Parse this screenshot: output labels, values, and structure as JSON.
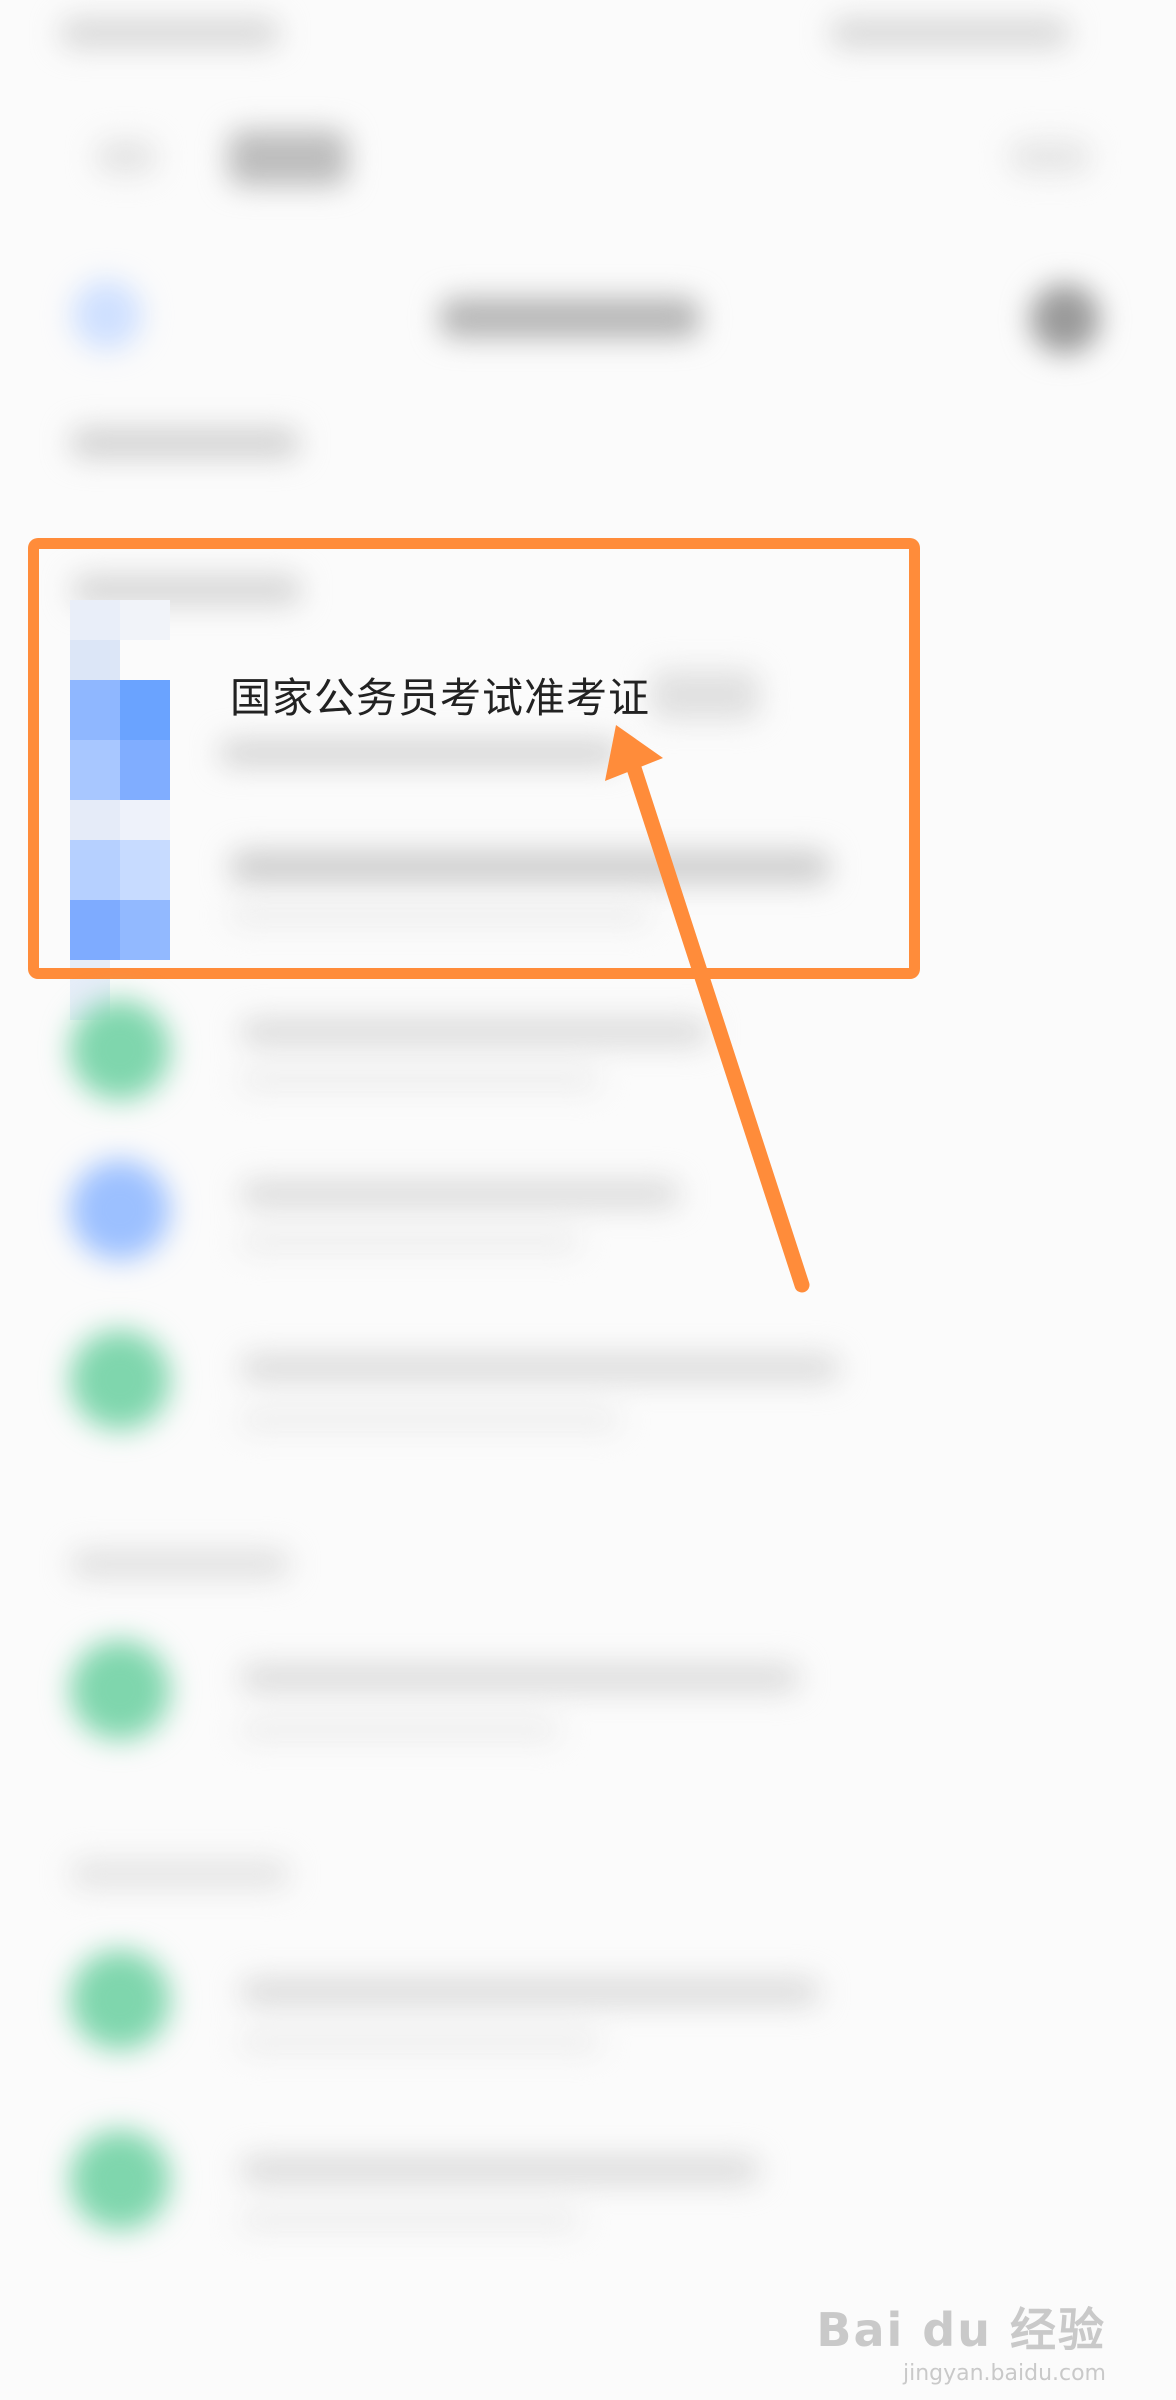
{
  "result_item": {
    "title": "国家公务员考试准考证"
  },
  "annotation": {
    "box_color": "#ff8c3a",
    "arrow_color": "#ff8c3a"
  },
  "watermark": {
    "brand": "Bai du 经验",
    "url": "jingyan.baidu.com"
  },
  "colors": {
    "avatar_green": "#7fd6ad",
    "avatar_blue": "#9cc0ff",
    "mosaic_blue": "#6aa3ff"
  }
}
